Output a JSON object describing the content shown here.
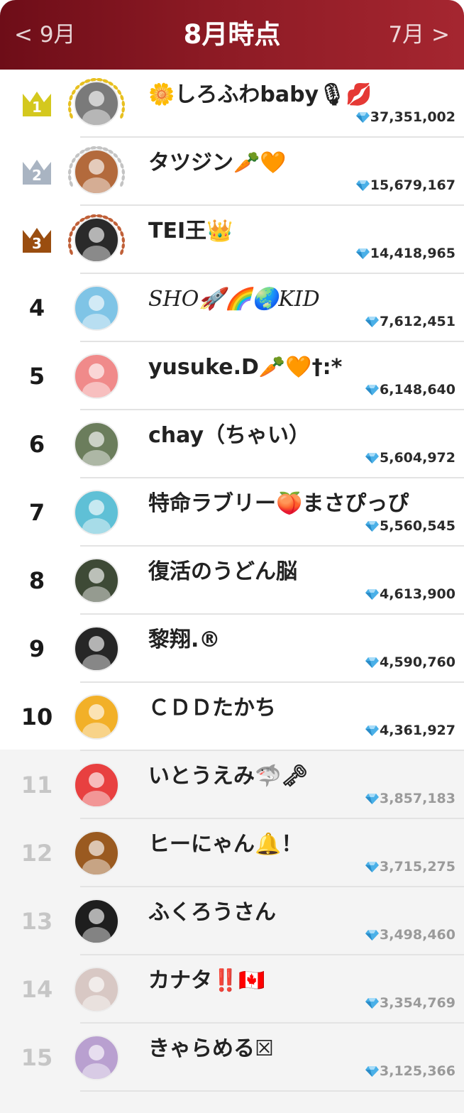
{
  "header": {
    "prev_label": "< 9月",
    "title": "8月時点",
    "next_label": "7月 >"
  },
  "colors": {
    "header_start": "#6e0d18",
    "header_end": "#a52630",
    "gold": "#d4c81e",
    "silver": "#a9b4c2",
    "bronze": "#9a4d0f",
    "gem": "#4ab0e8"
  },
  "ranking": [
    {
      "rank": "1",
      "name": "🌼しろふわbaby🎙💋",
      "score": "37,351,002",
      "crown": "gold",
      "avatar_color": "#7a7a7a"
    },
    {
      "rank": "2",
      "name": "タツジン🥕🧡",
      "score": "15,679,167",
      "crown": "silver",
      "avatar_color": "#b36a3c"
    },
    {
      "rank": "3",
      "name": "TEI王👑",
      "score": "14,418,965",
      "crown": "bronze",
      "avatar_color": "#2a2a2a"
    },
    {
      "rank": "4",
      "name": "SHO🚀🌈🌏KID",
      "score": "7,612,451",
      "crown": "",
      "avatar_color": "#7fc4e6"
    },
    {
      "rank": "5",
      "name": "yusuke.D🥕🧡†:*",
      "score": "6,148,640",
      "crown": "",
      "avatar_color": "#f08a8a"
    },
    {
      "rank": "6",
      "name": "chay（ちゃい）",
      "score": "5,604,972",
      "crown": "",
      "avatar_color": "#6b7d5c"
    },
    {
      "rank": "7",
      "name": "特命ラブリー🍑まさぴっぴ",
      "score": "5,560,545",
      "crown": "",
      "avatar_color": "#5fc0d6"
    },
    {
      "rank": "8",
      "name": "復活のうどん脳",
      "score": "4,613,900",
      "crown": "",
      "avatar_color": "#3e4a36"
    },
    {
      "rank": "9",
      "name": "黎翔.®",
      "score": "4,590,760",
      "crown": "",
      "avatar_color": "#262626"
    },
    {
      "rank": "10",
      "name": "ＣＤＤたかち",
      "score": "4,361,927",
      "crown": "",
      "avatar_color": "#f2b028"
    },
    {
      "rank": "11",
      "name": "いとうえみ🦈🗝",
      "score": "3,857,183",
      "crown": "",
      "avatar_color": "#e84040"
    },
    {
      "rank": "12",
      "name": "ヒーにゃん🔔！",
      "score": "3,715,275",
      "crown": "",
      "avatar_color": "#9a5a20"
    },
    {
      "rank": "13",
      "name": "ふくろうさん",
      "score": "3,498,460",
      "crown": "",
      "avatar_color": "#1e1e1e"
    },
    {
      "rank": "14",
      "name": "カナタ‼️🇨🇦",
      "score": "3,354,769",
      "crown": "",
      "avatar_color": "#d8c8c4"
    },
    {
      "rank": "15",
      "name": "きゃらめる☒",
      "score": "3,125,366",
      "crown": "",
      "avatar_color": "#b9a0d0"
    }
  ]
}
